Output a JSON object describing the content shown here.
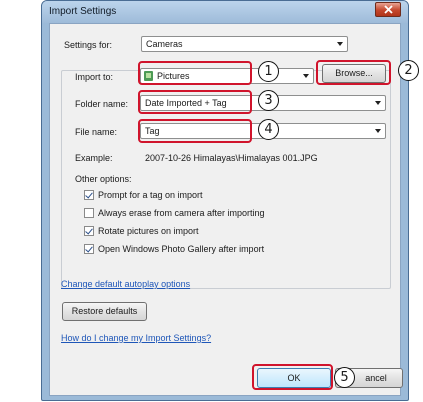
{
  "window": {
    "title": "Import Settings"
  },
  "settings_for": {
    "label": "Settings for:",
    "value": "Cameras"
  },
  "import_to": {
    "label": "Import to:",
    "value": "Pictures",
    "browse_label": "Browse..."
  },
  "folder_name": {
    "label": "Folder name:",
    "value": "Date Imported + Tag"
  },
  "file_name": {
    "label": "File name:",
    "value": "Tag"
  },
  "example": {
    "label": "Example:",
    "value": "2007-10-26 Himalayas\\Himalayas 001.JPG"
  },
  "other_options": {
    "label": "Other options:",
    "items": [
      {
        "label": "Prompt for a tag on import",
        "checked": true
      },
      {
        "label": "Always erase from camera after importing",
        "checked": false
      },
      {
        "label": "Rotate pictures on import",
        "checked": true
      },
      {
        "label": "Open Windows Photo Gallery after import",
        "checked": true
      }
    ]
  },
  "links": {
    "autoplay": "Change default autoplay options",
    "help": "How do I change my Import Settings?"
  },
  "buttons": {
    "restore": "Restore defaults",
    "ok": "OK",
    "cancel": "ancel"
  },
  "callouts": [
    "1",
    "2",
    "3",
    "4",
    "5"
  ],
  "colors": {
    "highlight": "#d0142c",
    "link": "#1e56b8",
    "close": "#c5472c"
  },
  "icons": {
    "close": "close-icon",
    "pictures": "pictures-folder-icon",
    "dropdown": "chevron-down-icon"
  }
}
